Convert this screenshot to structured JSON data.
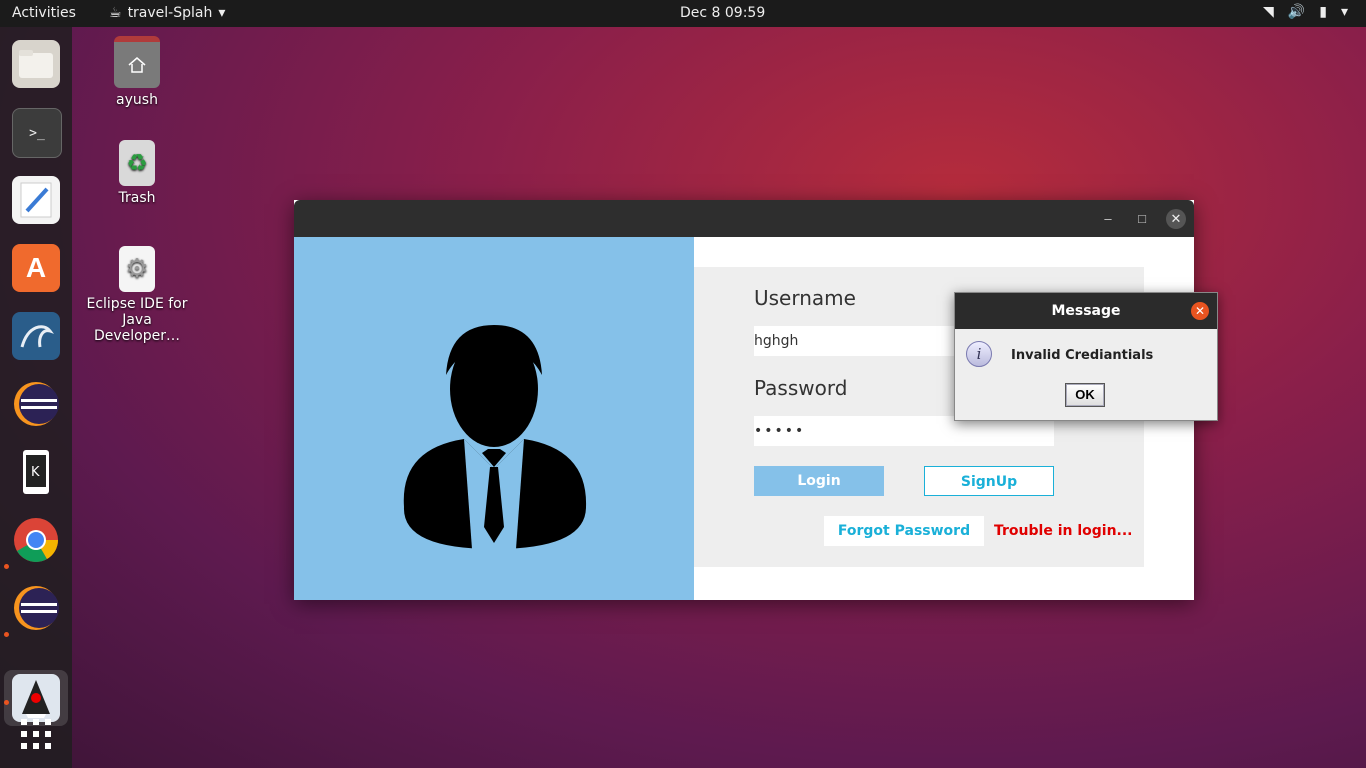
{
  "topbar": {
    "activities": "Activities",
    "app_name": "travel-Splah",
    "clock": "Dec 8  09:59"
  },
  "desktop": {
    "icons": [
      {
        "label": "ayush"
      },
      {
        "label": "Trash"
      },
      {
        "label": "Eclipse IDE for Java Developer…"
      }
    ]
  },
  "dock": {
    "items": [
      "files-icon",
      "terminal-icon",
      "text-editor-icon",
      "software-store-icon",
      "mysql-workbench-icon",
      "eclipse-icon",
      "kde-connect-icon",
      "chrome-icon",
      "eclipse-icon",
      "java-duke-icon",
      "show-apps-icon"
    ]
  },
  "login": {
    "username_label": "Username",
    "username_value": "hghgh",
    "password_label": "Password",
    "password_value": "•••••",
    "login_button": "Login",
    "signup_button": "SignUp",
    "forgot_button": "Forgot Password",
    "trouble_text": "Trouble in login..."
  },
  "dialog": {
    "title": "Message",
    "message": "Invalid Crediantials",
    "ok_button": "OK"
  },
  "colors": {
    "accent": "#e95420",
    "left_pane": "#85c1e9",
    "login_button": "#85c1e9",
    "trouble_text": "#e00000",
    "link_text": "#1ab0d8"
  }
}
